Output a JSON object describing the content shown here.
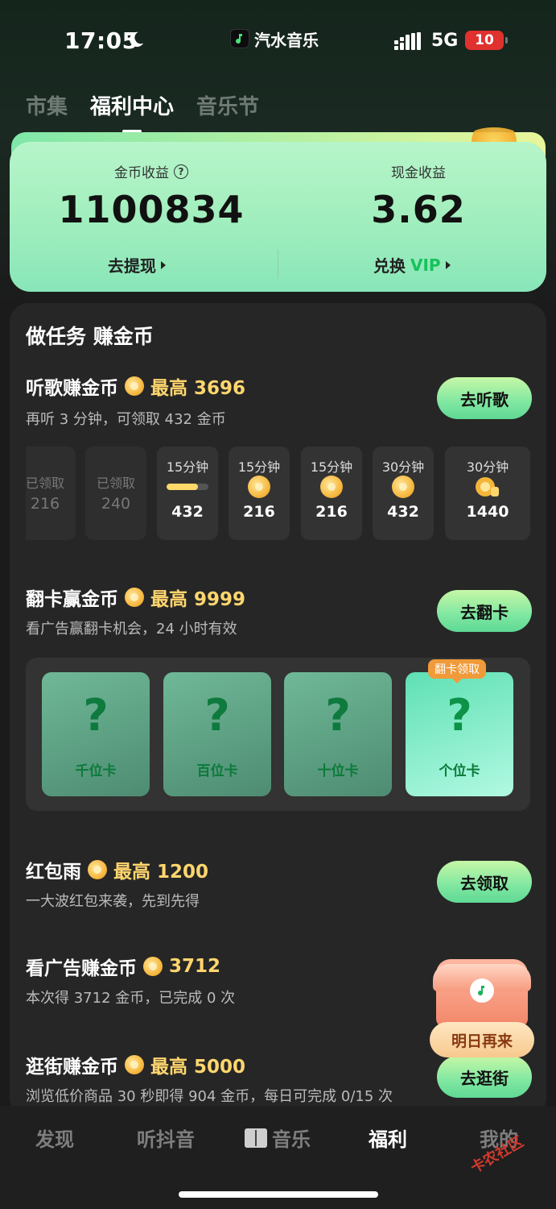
{
  "status_bar": {
    "time": "17:05",
    "app_name": "汽水音乐",
    "network": "5G",
    "battery": "10"
  },
  "top_tabs": [
    {
      "label": "市集"
    },
    {
      "label": "福利中心"
    },
    {
      "label": "音乐节"
    }
  ],
  "earnings": {
    "coin_label": "金币收益",
    "coin_value": "1100834",
    "cash_label": "现金收益",
    "cash_value": "3.62",
    "withdraw_label": "去提现",
    "exchange_label": "兑换",
    "exchange_vip": "VIP"
  },
  "panel": {
    "title": "做任务 赚金币"
  },
  "tasks": {
    "listen": {
      "title": "听歌赚金币",
      "max": "最高 3696",
      "sub": "再听 3 分钟，可领取 432 金币",
      "button": "去听歌",
      "slots": [
        {
          "top": "已领取",
          "value": "216",
          "state": "claimed"
        },
        {
          "top": "已领取",
          "value": "240",
          "state": "claimed"
        },
        {
          "top": "15分钟",
          "value": "432",
          "state": "progress",
          "progress": 0.75
        },
        {
          "top": "15分钟",
          "value": "216",
          "state": "coin"
        },
        {
          "top": "15分钟",
          "value": "216",
          "state": "coin"
        },
        {
          "top": "30分钟",
          "value": "432",
          "state": "coin"
        },
        {
          "top": "30分钟",
          "value": "1440",
          "state": "bag"
        }
      ]
    },
    "flip": {
      "title": "翻卡赢金币",
      "max": "最高 9999",
      "sub": "看广告赢翻卡机会，24 小时有效",
      "button": "去翻卡",
      "tag": "翻卡领取",
      "cards": [
        {
          "q": "?",
          "label": "千位卡"
        },
        {
          "q": "?",
          "label": "百位卡"
        },
        {
          "q": "?",
          "label": "十位卡"
        },
        {
          "q": "?",
          "label": "个位卡"
        }
      ]
    },
    "redpacket": {
      "title": "红包雨",
      "max": "最高 1200",
      "sub": "一大波红包来袭，先到先得",
      "button": "去领取"
    },
    "ads": {
      "title": "看广告赚金币",
      "max": "3712",
      "sub": "本次得 3712 金币，已完成 0 次"
    },
    "shop": {
      "title": "逛街赚金币",
      "max": "最高 5000",
      "sub": "浏览低价商品 30 秒即得 904 金币，每日可完成 0/15 次",
      "button": "去逛街"
    }
  },
  "chest": {
    "label": "明日再来"
  },
  "bottom_nav": [
    {
      "label": "发现"
    },
    {
      "label": "听抖音"
    },
    {
      "label": "音乐"
    },
    {
      "label": "福利"
    },
    {
      "label": "我的"
    }
  ],
  "watermark": "卡农社区",
  "colors": {
    "accent_green": "#16c25b",
    "coin_gold": "#ffd66e",
    "background": "#1b1b1b"
  }
}
